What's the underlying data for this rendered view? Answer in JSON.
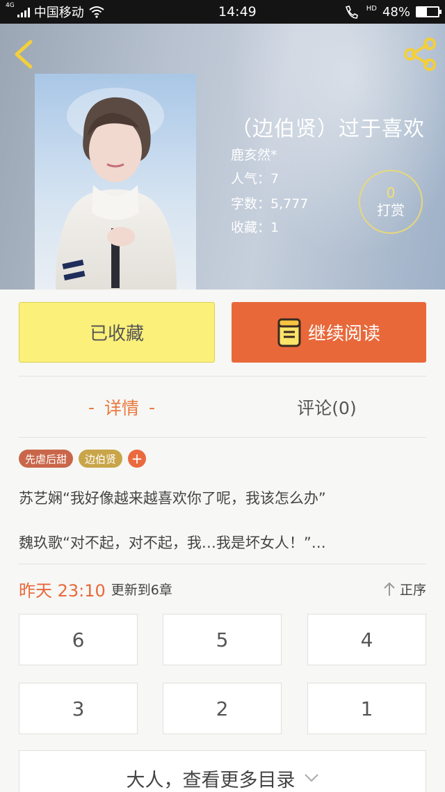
{
  "status_bar": {
    "network": "4G",
    "carrier": "中国移动",
    "time": "14:49",
    "hd": "HD",
    "battery": "48%",
    "battery_level": 0.48
  },
  "header": {
    "back_icon": "chevron-left-icon",
    "share_icon": "share-icon"
  },
  "book": {
    "title": "（边伯贤）过于喜欢",
    "author": "鹿亥然*",
    "popularity": "人气：7",
    "word_count": "字数：5,777",
    "favorites": "收藏：1",
    "reward_count": "0",
    "reward_label": "打赏"
  },
  "actions": {
    "collected_label": "已收藏",
    "read_label": "继续阅读"
  },
  "tabs": [
    {
      "label": "详情",
      "dash": "-"
    },
    {
      "label": "评论(0)"
    }
  ],
  "tags": [
    "先虐后甜",
    "边伯贤"
  ],
  "tag_add": "+",
  "summary": [
    "苏艺娴“我好像越来越喜欢你了呢，我该怎么办”",
    "魏玖歌“对不起，对不起，我…我是坏女人！”…"
  ],
  "update": {
    "time": "昨天 23:10",
    "text": "更新到6章",
    "sort_label": "正序"
  },
  "chapters": [
    "6",
    "5",
    "4",
    "3",
    "2",
    "1"
  ],
  "more_label": "大人，查看更多目录",
  "colors": {
    "accent": "#e8683a",
    "collected_bg": "#fbf07a",
    "reward_ring": "#e8d87a"
  }
}
